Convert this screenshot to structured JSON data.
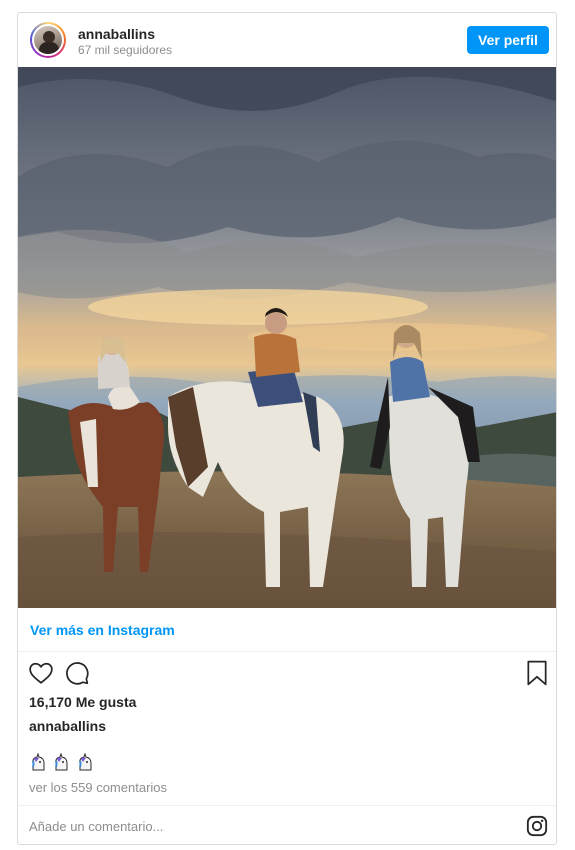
{
  "post": {
    "username": "annaballins",
    "followers": "67 mil seguidores",
    "view_profile_label": "Ver perfil",
    "photo_icon": "photo-icon",
    "view_on_instagram_label": "Ver más en Instagram",
    "likes_text": "16,170 Me gusta",
    "caption_username": "annaballins",
    "caption_emojis": [
      "unicorn-emoji",
      "unicorn-emoji",
      "unicorn-emoji"
    ],
    "view_comments_text": "ver los 559 comentarios",
    "comment_placeholder": "Añade un comentario..."
  },
  "icons": {
    "like": "heart-icon",
    "comment": "comment-bubble-icon",
    "save": "bookmark-icon",
    "instagram": "instagram-logo-icon"
  },
  "colors": {
    "accent": "#0095f6",
    "text": "#262626",
    "muted": "#8e8e8e",
    "border": "#dbdbdb"
  }
}
